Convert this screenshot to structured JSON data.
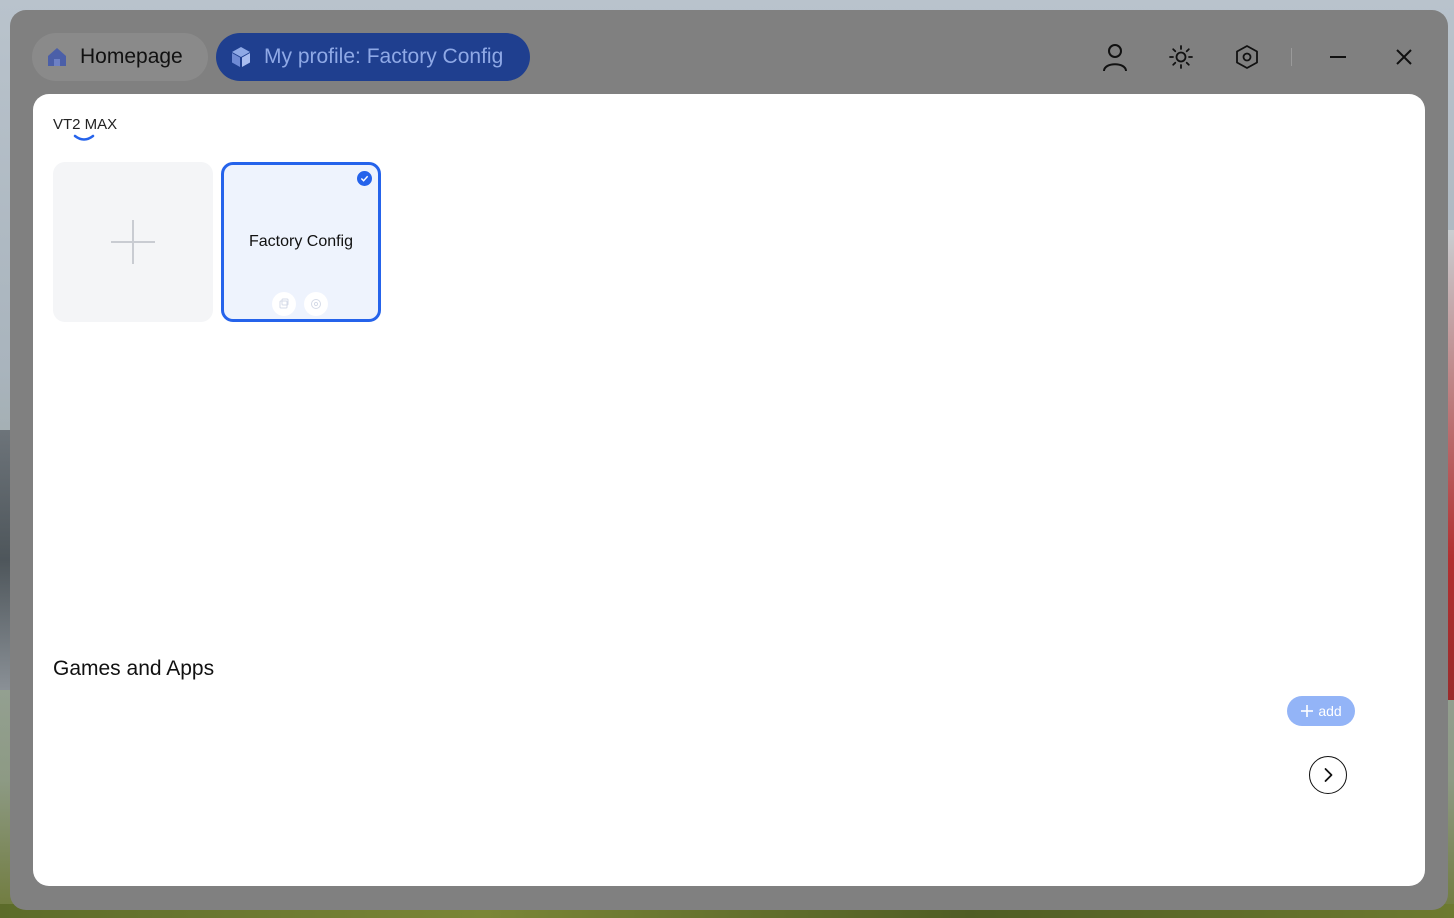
{
  "tabs": {
    "home_label": "Homepage",
    "profile_label": "My profile: Factory Config"
  },
  "toolbar": {
    "icons": [
      "user-icon",
      "brightness-icon",
      "settings-hex-icon",
      "minimize-icon",
      "close-icon"
    ]
  },
  "device": {
    "name": "VT2 MAX"
  },
  "profiles": [
    {
      "name": "Factory Config",
      "selected": true
    }
  ],
  "games_section": {
    "title": "Games and Apps",
    "add_label": "add"
  },
  "colors": {
    "accent": "#2563eb",
    "profile_tab_bg": "#1f3f8f",
    "add_button_bg": "#93b4f7",
    "window_bg": "#808080"
  }
}
